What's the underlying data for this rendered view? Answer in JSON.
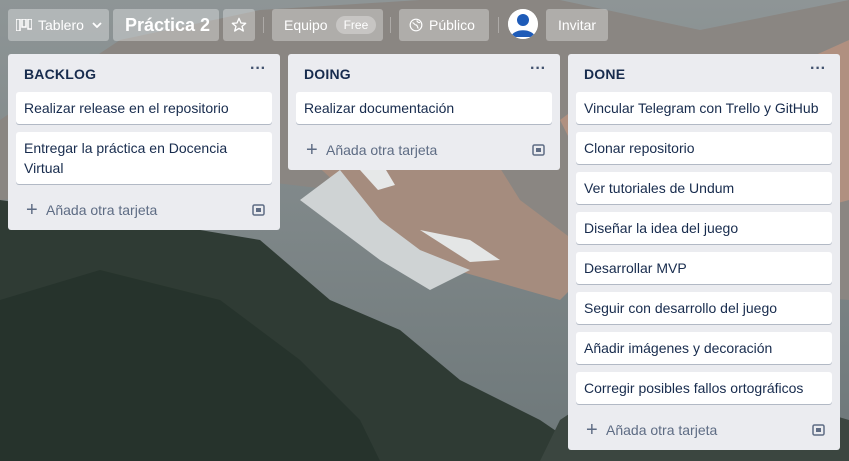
{
  "header": {
    "board_switch_label": "Tablero",
    "board_title": "Práctica 2",
    "team_label": "Equipo",
    "team_badge": "Free",
    "visibility_label": "Público",
    "invite_label": "Invitar"
  },
  "lists": [
    {
      "title": "BACKLOG",
      "menu": "···",
      "cards": [
        "Realizar release en el repositorio",
        "Entregar la práctica en Docencia Virtual"
      ],
      "add_label": "Añada otra tarjeta"
    },
    {
      "title": "DOING",
      "menu": "···",
      "cards": [
        "Realizar documentación"
      ],
      "add_label": "Añada otra tarjeta"
    },
    {
      "title": "DONE",
      "menu": "···",
      "cards": [
        "Vincular Telegram con Trello y GitHub",
        "Clonar repositorio",
        "Ver tutoriales de Undum",
        "Diseñar la idea del juego",
        "Desarrollar MVP",
        "Seguir con desarrollo del juego",
        "Añadir imágenes y decoración",
        "Corregir posibles fallos ortográficos"
      ],
      "add_label": "Añada otra tarjeta"
    }
  ],
  "icons": {
    "board_switch": "board-icon",
    "chevron": "chevron-down-icon",
    "star": "star-icon",
    "visibility": "globe-icon",
    "avatar": "user-avatar-icon",
    "add": "plus-icon",
    "template": "card-template-icon"
  },
  "colors": {
    "list_bg": "#ebecf0",
    "card_text": "#172b4d",
    "muted_text": "#5e6c84"
  }
}
